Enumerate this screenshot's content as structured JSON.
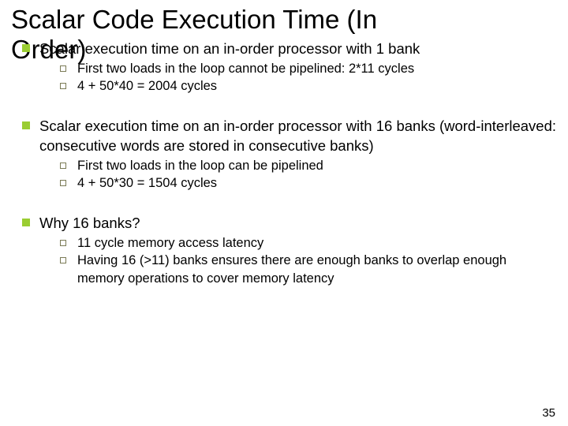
{
  "title_line1": "Scalar Code Execution Time (In",
  "title_line2": "Order)",
  "section1": {
    "heading": "Scalar execution time on an in-order processor with 1 bank",
    "items": [
      "First two loads in the loop cannot be pipelined: 2*11 cycles",
      "4 + 50*40 = 2004 cycles"
    ]
  },
  "section2": {
    "heading": "Scalar execution time on an in-order processor with 16 banks (word-interleaved: consecutive words are stored in consecutive banks)",
    "items": [
      "First two loads in the loop can be pipelined",
      "4 + 50*30 = 1504 cycles"
    ]
  },
  "section3": {
    "heading": "Why 16 banks?",
    "items": [
      "11 cycle memory access latency",
      "Having 16 (>11) banks ensures there are enough banks to overlap enough memory operations to cover memory latency"
    ]
  },
  "page_number": "35"
}
